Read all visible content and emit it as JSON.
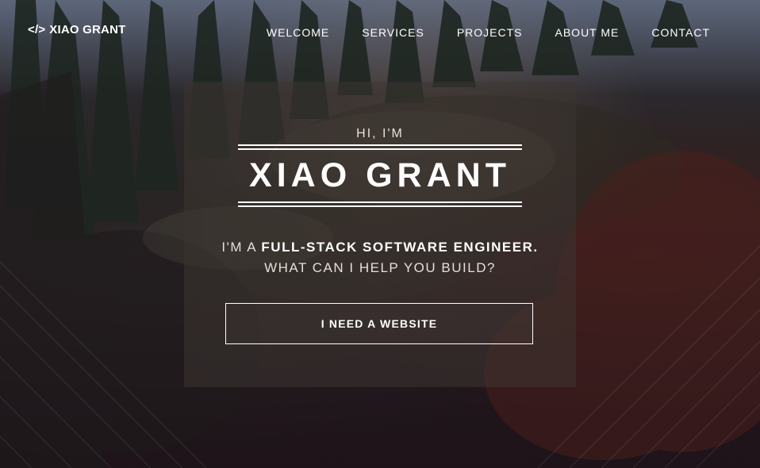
{
  "brand": {
    "icon": "code-icon",
    "icon_glyph": "</>",
    "name": "XIAO GRANT"
  },
  "nav": {
    "items": [
      {
        "label": "WELCOME"
      },
      {
        "label": "SERVICES"
      },
      {
        "label": "PROJECTS"
      },
      {
        "label": "ABOUT ME"
      },
      {
        "label": "CONTACT"
      }
    ]
  },
  "hero": {
    "greeting": "HI, I'M",
    "name": "XIAO GRANT",
    "tagline_prefix": "I'M A ",
    "tagline_bold": "FULL-STACK SOFTWARE ENGINEER.",
    "tagline_line2": "WHAT CAN I HELP YOU BUILD?",
    "cta_label": "I NEED A WEBSITE"
  },
  "colors": {
    "text": "#ffffff",
    "card_overlay": "#3c3432"
  }
}
